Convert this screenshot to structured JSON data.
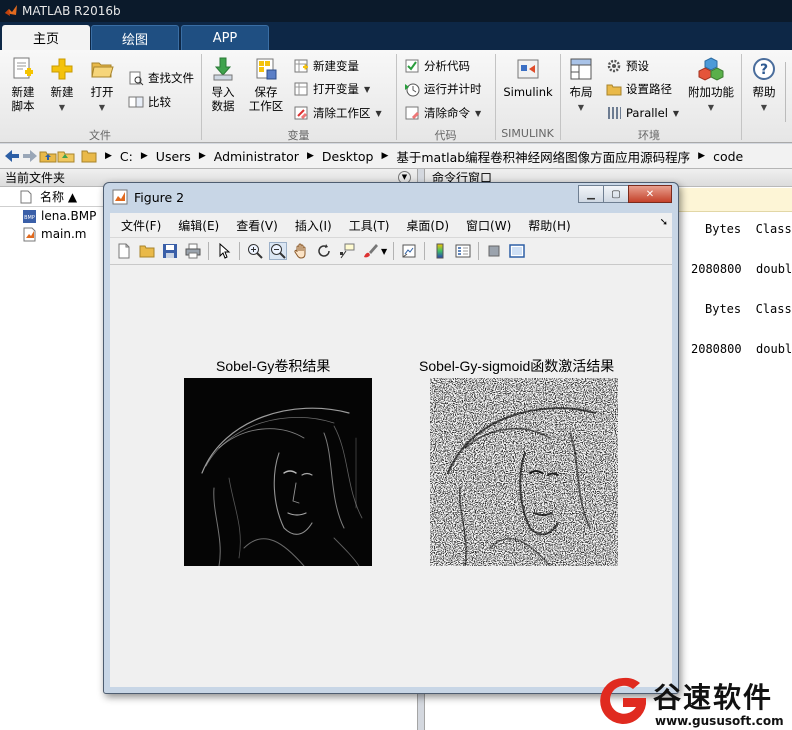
{
  "app": {
    "title": "MATLAB R2016b"
  },
  "tabs": [
    {
      "label": "主页"
    },
    {
      "label": "绘图"
    },
    {
      "label": "APP"
    }
  ],
  "ribbon": {
    "new_script": "新建\n脚本",
    "new": "新建",
    "open": "打开",
    "find_files": "查找文件",
    "compare": "比较",
    "import_data": "导入\n数据",
    "save_workspace": "保存\n工作区",
    "new_variable": "新建变量",
    "open_variable": "打开变量",
    "clear_workspace": "清除工作区",
    "analyze_code": "分析代码",
    "run_and_time": "运行并计时",
    "clear_commands": "清除命令",
    "simulink": "Simulink",
    "layout": "布局",
    "preferences": "预设",
    "set_path": "设置路径",
    "parallel": "Parallel",
    "addons": "附加功能",
    "help": "帮助",
    "groups": {
      "file": "文件",
      "variable": "变量",
      "code": "代码",
      "simulink": "SIMULINK",
      "environment": "环境"
    }
  },
  "address": {
    "crumbs": [
      "C:",
      "Users",
      "Administrator",
      "Desktop",
      "基于matlab编程卷积神经网络图像方面应用源码程序",
      "code"
    ]
  },
  "current_folder": {
    "title": "当前文件夹",
    "column_name": "名称 ▲",
    "files": [
      {
        "name": "lena.BMP"
      },
      {
        "name": "main.m"
      }
    ]
  },
  "command_window": {
    "title": "命令行窗口",
    "lines": [
      "Bytes  Class",
      "2080800  double",
      "Bytes  Class",
      "2080800  double"
    ]
  },
  "figure": {
    "title": "Figure 2",
    "menu": [
      "文件(F)",
      "编辑(E)",
      "查看(V)",
      "插入(I)",
      "工具(T)",
      "桌面(D)",
      "窗口(W)",
      "帮助(H)"
    ],
    "axes": [
      {
        "title": "Sobel-Gy卷积结果"
      },
      {
        "title": "Sobel-Gy-sigmoid函数激活结果"
      }
    ]
  },
  "watermark": {
    "brand": "谷速软件",
    "url": "www.gususoft.com"
  }
}
